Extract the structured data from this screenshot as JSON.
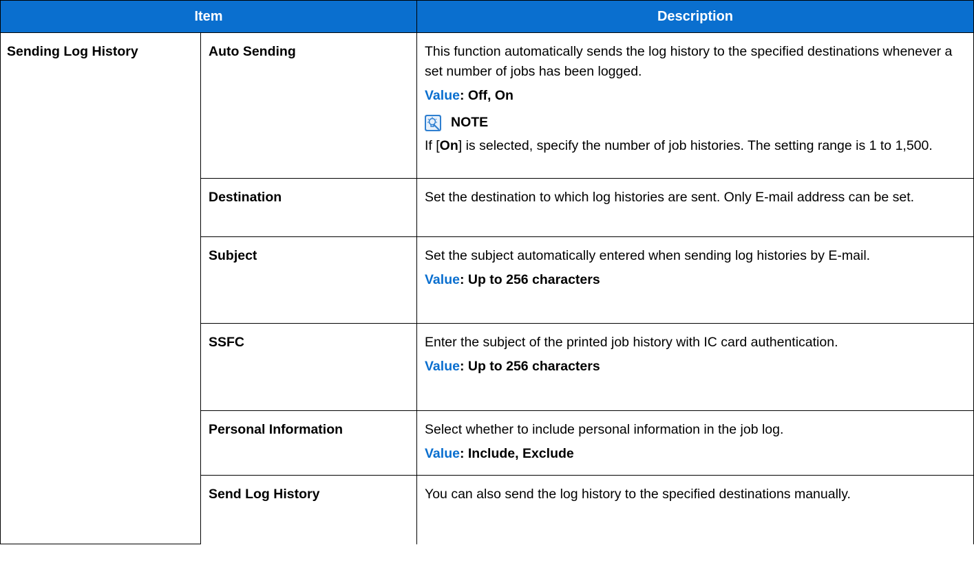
{
  "header": {
    "item": "Item",
    "description": "Description"
  },
  "group_label": "Sending Log History",
  "rows": [
    {
      "item": "Auto Sending",
      "description": "This function automatically sends the log history to the specified destinations whenever a set number of jobs has been logged.",
      "value_label": "Value",
      "value_text": ": Off, On",
      "note": {
        "icon": "note-lightbulb-icon",
        "title": "NOTE",
        "text_before": "If [",
        "text_bold": "On",
        "text_after": "] is selected, specify the number of job histories. The setting range is 1 to 1,500."
      }
    },
    {
      "item": "Destination",
      "description": "Set the destination to which log histories are sent. Only E-mail address can be set."
    },
    {
      "item": "Subject",
      "description": "Set the subject automatically entered when sending log histories by E-mail.",
      "value_label": "Value",
      "value_text": ": Up to 256 characters"
    },
    {
      "item": "SSFC",
      "description": "Enter the subject of the printed job history with IC card authentication.",
      "value_label": "Value",
      "value_text": ": Up to 256 characters"
    },
    {
      "item": "Personal Information",
      "description": "Select whether to include personal information in the job log.",
      "value_label": "Value",
      "value_text": ": Include, Exclude"
    },
    {
      "item": "Send Log History",
      "description": "You can also send the log history to the specified destinations manually."
    }
  ],
  "colors": {
    "header_bg": "#0a6fcf",
    "value_label": "#0a6fcf"
  }
}
